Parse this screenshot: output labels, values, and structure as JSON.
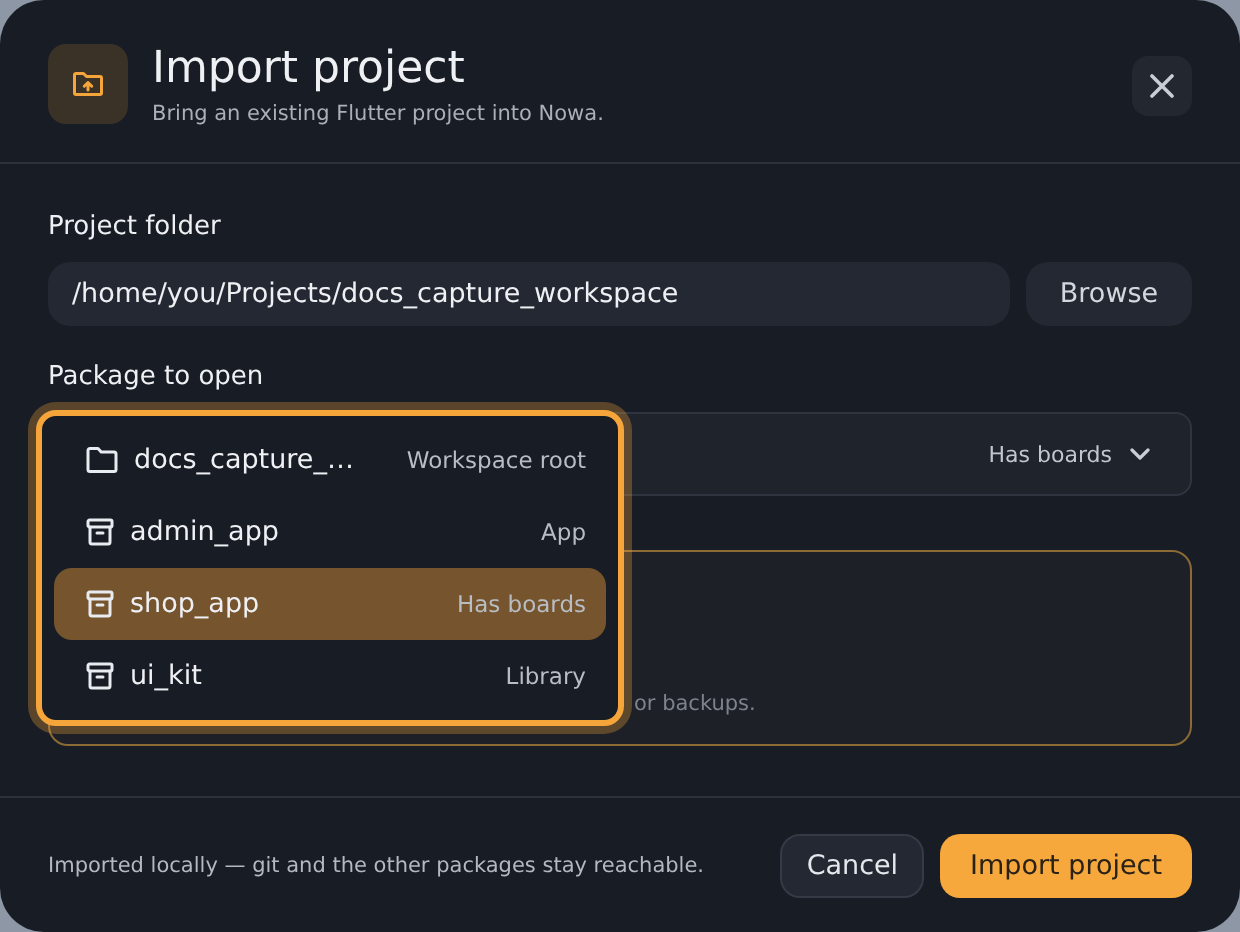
{
  "dialog": {
    "title": "Import project",
    "subtitle": "Bring an existing Flutter project into Nowa."
  },
  "project_folder": {
    "label": "Project folder",
    "value": "/home/you/Projects/docs_capture_workspace",
    "browse": "Browse"
  },
  "package": {
    "label": "Package to open",
    "badge": "Has boards",
    "expanded": true,
    "options": [
      {
        "kind": "folder",
        "name": "docs_capture_…",
        "tag": "Workspace root",
        "selected": false
      },
      {
        "kind": "package",
        "name": "admin_app",
        "tag": "App",
        "selected": false
      },
      {
        "kind": "package",
        "name": "shop_app",
        "tag": "Has boards",
        "selected": true
      },
      {
        "kind": "package",
        "name": "ui_kit",
        "tag": "Library",
        "selected": false
      }
    ]
  },
  "hidden_box": {
    "note": "or backups."
  },
  "footer": {
    "note": "Imported locally — git and the other packages stay reachable.",
    "cancel": "Cancel",
    "confirm": "Import project"
  }
}
